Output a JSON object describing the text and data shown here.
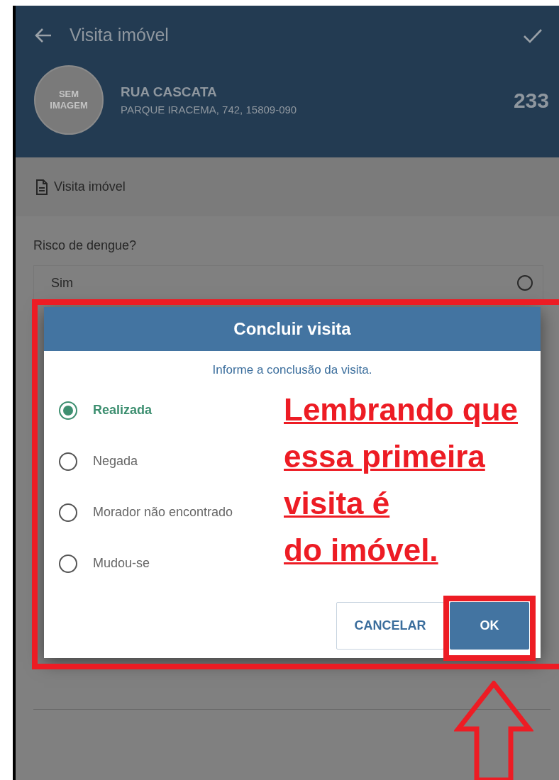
{
  "app_bar": {
    "title": "Visita imóvel"
  },
  "property": {
    "avatar_text": "SEM IMAGEM",
    "street": "RUA CASCATA",
    "address": "PARQUE IRACEMA, 742, 15809-090",
    "number": "233"
  },
  "section": {
    "title": "Visita imóvel"
  },
  "form": {
    "question": "Risco de dengue?",
    "options": [
      {
        "label": "Sim",
        "selected": false
      }
    ]
  },
  "dialog": {
    "title": "Concluir visita",
    "message": "Informe a conclusão da visita.",
    "options": [
      {
        "label": "Realizada",
        "selected": true
      },
      {
        "label": "Negada",
        "selected": false
      },
      {
        "label": "Morador não encontrado",
        "selected": false
      },
      {
        "label": "Mudou-se",
        "selected": false
      }
    ],
    "buttons": [
      {
        "label": "CANCELAR",
        "kind": "secondary"
      },
      {
        "label": "OK",
        "kind": "primary"
      }
    ]
  },
  "annotation": {
    "lines": [
      "Lembrando que",
      "essa primeira",
      "visita é",
      "do imóvel."
    ]
  }
}
